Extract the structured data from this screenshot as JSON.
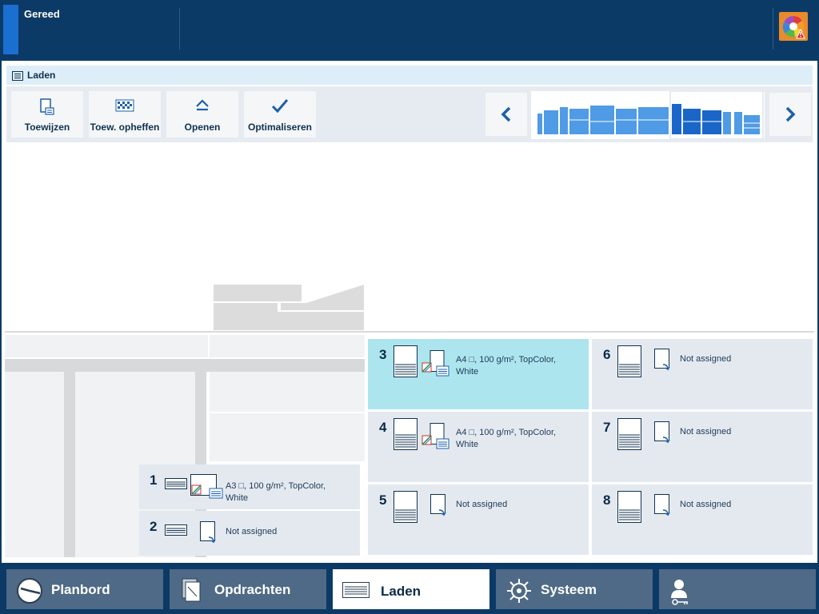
{
  "header": {
    "status": "Gereed",
    "alert_icon": "color-wheel-warning-icon",
    "accent": "#1a6fd1"
  },
  "panel": {
    "title": "Laden"
  },
  "toolbar": {
    "buttons": [
      {
        "label": "Toewijzen",
        "icon": "assign-tray-icon"
      },
      {
        "label": "Toew. opheffen",
        "icon": "unassign-tray-icon"
      },
      {
        "label": "Openen",
        "icon": "eject-icon"
      },
      {
        "label": "Optimaliseren",
        "icon": "checkmark-icon"
      }
    ],
    "prev_icon": "chevron-left-icon",
    "next_icon": "chevron-right-icon"
  },
  "trays": [
    {
      "number": "1",
      "media_line1": "A3 □, 100 g/m², TopColor,",
      "media_line2": "White",
      "assigned": true
    },
    {
      "number": "2",
      "media_line1": "Not assigned",
      "media_line2": "",
      "assigned": false
    },
    {
      "number": "3",
      "media_line1": "A4 □, 100 g/m², TopColor,",
      "media_line2": "White",
      "assigned": true,
      "selected": true
    },
    {
      "number": "4",
      "media_line1": "A4 □, 100 g/m², TopColor,",
      "media_line2": "White",
      "assigned": true
    },
    {
      "number": "5",
      "media_line1": "Not assigned",
      "media_line2": "",
      "assigned": false
    },
    {
      "number": "6",
      "media_line1": "Not assigned",
      "media_line2": "",
      "assigned": false
    },
    {
      "number": "7",
      "media_line1": "Not assigned",
      "media_line2": "",
      "assigned": false
    },
    {
      "number": "8",
      "media_line1": "Not assigned",
      "media_line2": "",
      "assigned": false
    }
  ],
  "bottom_nav": [
    {
      "label": "Planbord",
      "icon": "clock-icon",
      "active": false
    },
    {
      "label": "Opdrachten",
      "icon": "jobs-icon",
      "active": false
    },
    {
      "label": "Laden",
      "icon": "trays-icon",
      "active": true
    },
    {
      "label": "Systeem",
      "icon": "gear-wheel-icon",
      "active": false
    },
    {
      "label": "",
      "icon": "user-key-icon",
      "active": false
    }
  ],
  "colors": {
    "selected_tray": "#ade5ef",
    "tray": "#e4e9f0",
    "nav_bg": "#0c3a66",
    "nav_item": "#4f6a86"
  }
}
